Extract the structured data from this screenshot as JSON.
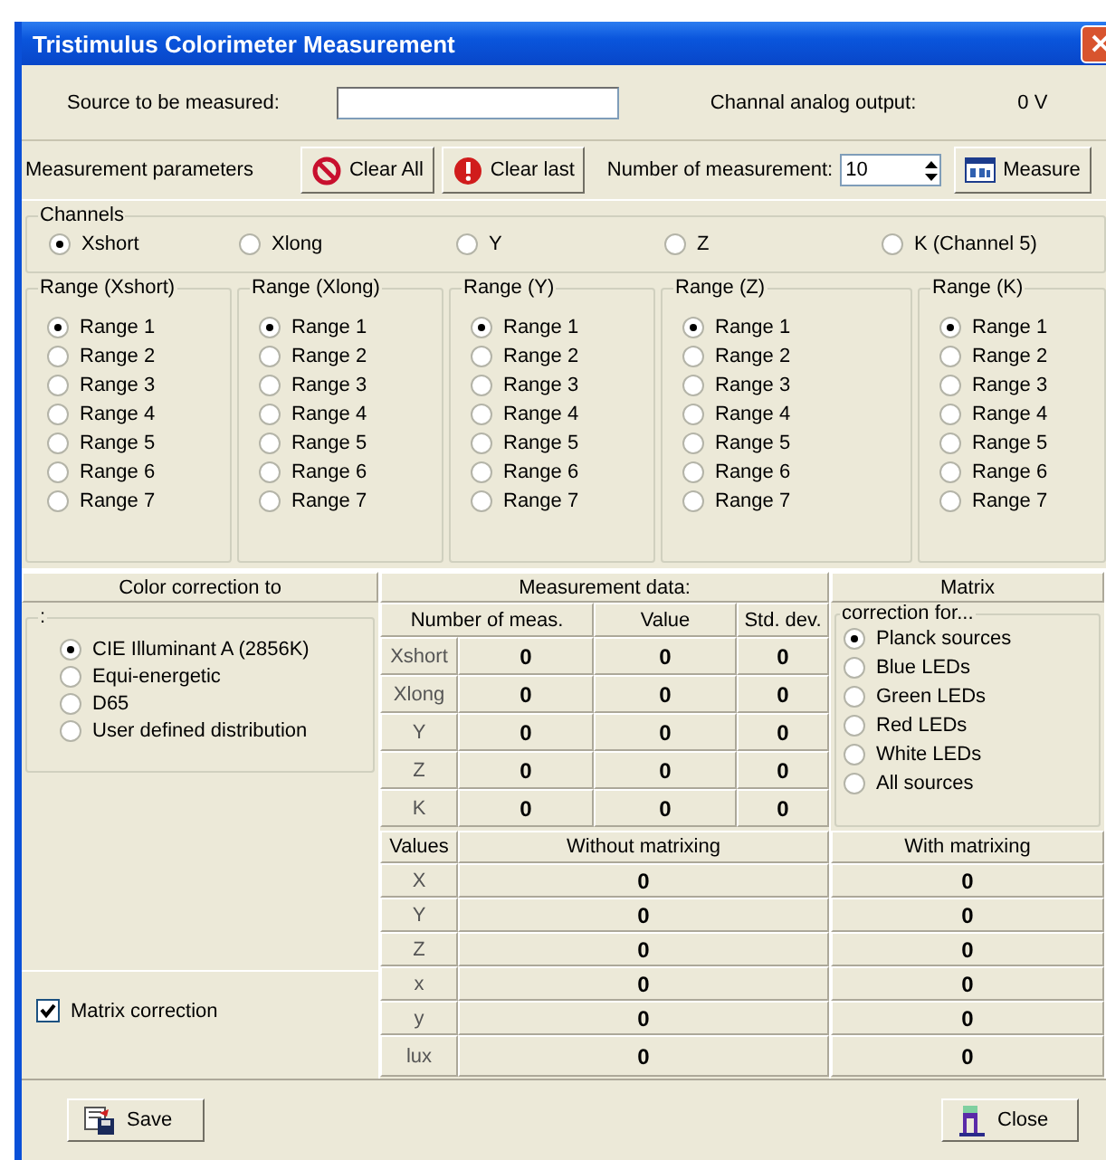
{
  "window": {
    "title": "Tristimulus Colorimeter Measurement"
  },
  "source": {
    "label": "Source to be measured:"
  },
  "output": {
    "label": "Channal analog output:",
    "value": "0 V"
  },
  "parameters": {
    "label": "Measurement parameters",
    "buttons": [
      {
        "label": "Clear All",
        "kind": "clear-all"
      },
      {
        "label": "Clear last",
        "kind": "clear-last"
      }
    ],
    "count_label": "Number of measurement:",
    "count_value": "10",
    "measure_button": "Measure"
  },
  "channels": {
    "title": "Channels",
    "options": [
      {
        "label": "Xshort",
        "selected": true
      },
      {
        "label": "Xlong",
        "selected": false
      },
      {
        "label": "Y",
        "selected": false
      },
      {
        "label": "Z",
        "selected": false
      },
      {
        "label": "K (Channel 5)",
        "selected": false
      }
    ]
  },
  "ranges": [
    {
      "title": "Range (Xshort)",
      "options": [
        {
          "label": "Range 1",
          "selected": true
        },
        {
          "label": "Range 2",
          "selected": false
        },
        {
          "label": "Range 3",
          "selected": false
        },
        {
          "label": "Range 4",
          "selected": false
        },
        {
          "label": "Range 5",
          "selected": false
        },
        {
          "label": "Range 6",
          "selected": false
        },
        {
          "label": "Range 7",
          "selected": false
        }
      ]
    },
    {
      "title": "Range (Xlong)",
      "options": [
        {
          "label": "Range 1",
          "selected": true
        },
        {
          "label": "Range 2",
          "selected": false
        },
        {
          "label": "Range 3",
          "selected": false
        },
        {
          "label": "Range 4",
          "selected": false
        },
        {
          "label": "Range 5",
          "selected": false
        },
        {
          "label": "Range 6",
          "selected": false
        },
        {
          "label": "Range 7",
          "selected": false
        }
      ]
    },
    {
      "title": "Range (Y)",
      "options": [
        {
          "label": "Range 1",
          "selected": true
        },
        {
          "label": "Range 2",
          "selected": false
        },
        {
          "label": "Range 3",
          "selected": false
        },
        {
          "label": "Range 4",
          "selected": false
        },
        {
          "label": "Range 5",
          "selected": false
        },
        {
          "label": "Range 6",
          "selected": false
        },
        {
          "label": "Range 7",
          "selected": false
        }
      ]
    },
    {
      "title": "Range (Z)",
      "options": [
        {
          "label": "Range 1",
          "selected": true
        },
        {
          "label": "Range 2",
          "selected": false
        },
        {
          "label": "Range 3",
          "selected": false
        },
        {
          "label": "Range 4",
          "selected": false
        },
        {
          "label": "Range 5",
          "selected": false
        },
        {
          "label": "Range 6",
          "selected": false
        },
        {
          "label": "Range 7",
          "selected": false
        }
      ]
    },
    {
      "title": "Range (K)",
      "options": [
        {
          "label": "Range 1",
          "selected": true
        },
        {
          "label": "Range 2",
          "selected": false
        },
        {
          "label": "Range 3",
          "selected": false
        },
        {
          "label": "Range 4",
          "selected": false
        },
        {
          "label": "Range 5",
          "selected": false
        },
        {
          "label": "Range 6",
          "selected": false
        },
        {
          "label": "Range 7",
          "selected": false
        }
      ]
    }
  ],
  "color_correction": {
    "header": "Color correction to",
    "group_title": ":",
    "options": [
      {
        "label": "CIE Illuminant A (2856K)",
        "selected": true
      },
      {
        "label": "Equi-energetic",
        "selected": false
      },
      {
        "label": "D65",
        "selected": false
      },
      {
        "label": "User defined distribution",
        "selected": false
      }
    ],
    "matrix_correction": {
      "label": "Matrix correction",
      "checked": true
    }
  },
  "measurement": {
    "title": "Measurement data:",
    "columns": [
      "Number of meas.",
      "Value",
      "Std. dev."
    ],
    "rows": [
      {
        "label": "Xshort",
        "cells": [
          "0",
          "0",
          "0"
        ]
      },
      {
        "label": "Xlong",
        "cells": [
          "0",
          "0",
          "0"
        ]
      },
      {
        "label": "Y",
        "cells": [
          "0",
          "0",
          "0"
        ]
      },
      {
        "label": "Z",
        "cells": [
          "0",
          "0",
          "0"
        ]
      },
      {
        "label": "K",
        "cells": [
          "0",
          "0",
          "0"
        ]
      }
    ]
  },
  "matrix": {
    "header": "Matrix",
    "group_title": "correction for...",
    "options": [
      {
        "label": "Planck sources",
        "selected": true
      },
      {
        "label": "Blue LEDs",
        "selected": false
      },
      {
        "label": "Green LEDs",
        "selected": false
      },
      {
        "label": "Red LEDs",
        "selected": false
      },
      {
        "label": "White LEDs",
        "selected": false
      },
      {
        "label": "All sources",
        "selected": false
      }
    ]
  },
  "values": {
    "columns": [
      "Values",
      "Without matrixing",
      "With matrixing"
    ],
    "rows": [
      {
        "label": "X",
        "without": "0",
        "with": "0"
      },
      {
        "label": "Y",
        "without": "0",
        "with": "0"
      },
      {
        "label": "Z",
        "without": "0",
        "with": "0"
      },
      {
        "label": "x",
        "without": "0",
        "with": "0"
      },
      {
        "label": "y",
        "without": "0",
        "with": "0"
      },
      {
        "label": "lux",
        "without": "0",
        "with": "0"
      }
    ]
  },
  "footer": {
    "save": "Save",
    "close": "Close"
  }
}
